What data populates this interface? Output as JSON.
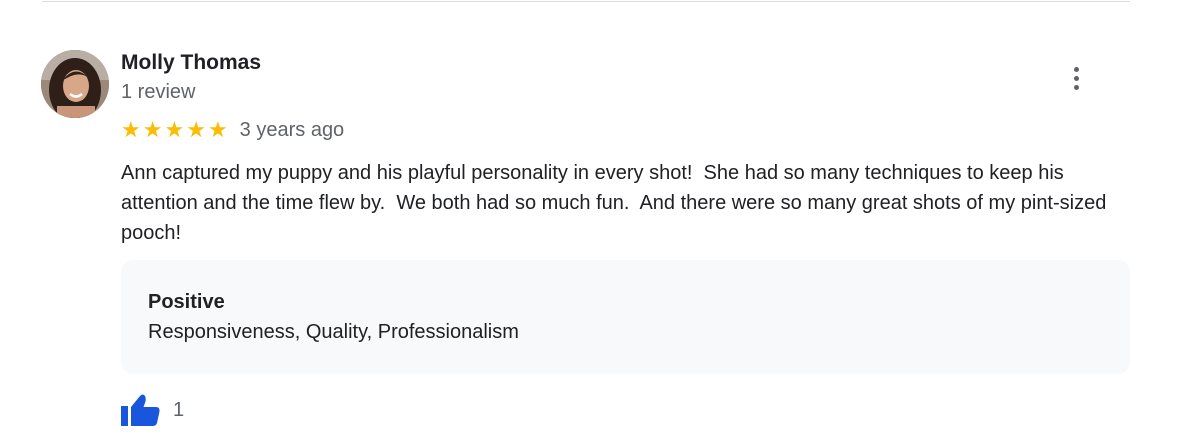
{
  "review": {
    "reviewer_name": "Molly Thomas",
    "review_count": "1 review",
    "rating": 5,
    "stars": [
      "★",
      "★",
      "★",
      "★",
      "★"
    ],
    "date": "3 years ago",
    "text": "Ann captured my puppy and his playful personality in every shot!  She had so many techniques to keep his attention and the time flew by.  We both had so much fun.  And there were so many great shots of my pint-sized pooch!",
    "attributes": {
      "heading": "Positive",
      "values": "Responsiveness, Quality, Professionalism"
    },
    "likes": "1"
  },
  "icons": {
    "more": "more-vert-icon",
    "like": "thumbs-up-icon",
    "star": "star-icon"
  },
  "colors": {
    "star": "#fbbc04",
    "like_icon": "#1a56db",
    "secondary_text": "#5f6368",
    "attributes_background": "#f8f9fa"
  }
}
